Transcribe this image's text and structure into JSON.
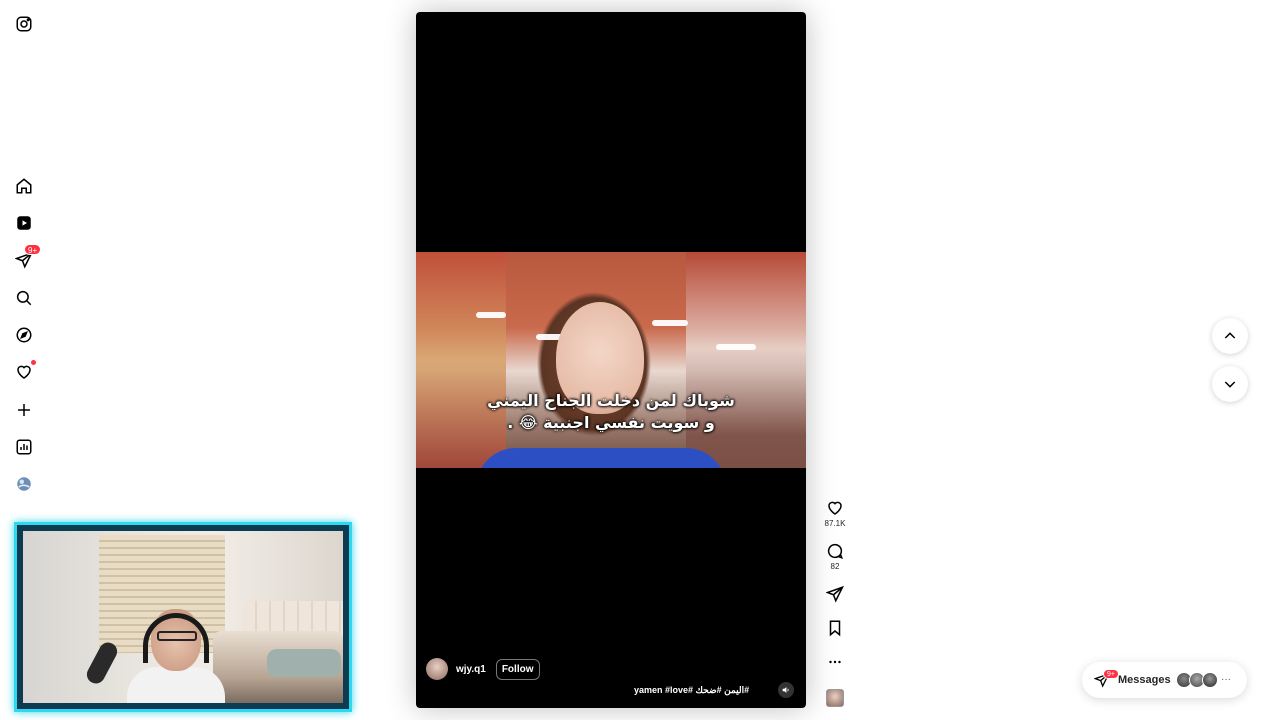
{
  "sidebar": {
    "items": [
      {
        "name": "instagram-logo-icon"
      },
      {
        "name": "home-icon"
      },
      {
        "name": "reels-icon"
      },
      {
        "name": "direct-icon",
        "badge": "9+"
      },
      {
        "name": "search-icon"
      },
      {
        "name": "explore-icon"
      },
      {
        "name": "notifications-heart-icon"
      },
      {
        "name": "create-plus-icon"
      },
      {
        "name": "dashboard-icon"
      },
      {
        "name": "profile-avatar"
      }
    ]
  },
  "reel": {
    "caption_line1": "شوباك لمن دخلت الجناح اليمني",
    "caption_line2": "و سويت نفسي اجنبية 😂 .",
    "username": "wjy.q1",
    "follow_label": "Follow",
    "hashtags": "yamen #love# اليمن #ضحك#"
  },
  "actions": {
    "likes": "87.1K",
    "comments": "82"
  },
  "messages": {
    "label": "Messages",
    "badge": "9+",
    "more": "···"
  },
  "colors": {
    "accent_red": "#ff3040",
    "webcam_border": "#2fd8ee"
  }
}
